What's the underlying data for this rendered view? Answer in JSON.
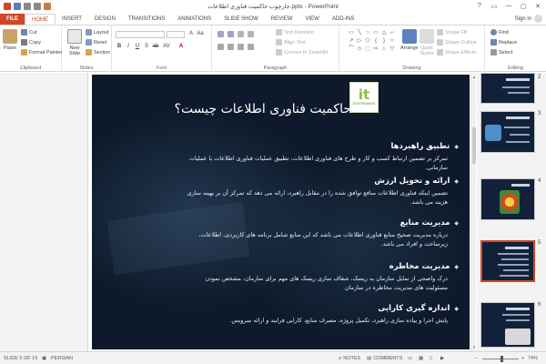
{
  "window": {
    "title": "جارچوب حاکمیت فناوری اطلاعات.pptx - PowerPoint",
    "controls": [
      "?",
      "▭",
      "—",
      "▢",
      "✕"
    ]
  },
  "ribbon_tabs": [
    "FILE",
    "HOME",
    "INSERT",
    "DESIGN",
    "TRANSITIONS",
    "ANIMATIONS",
    "SLIDE SHOW",
    "REVIEW",
    "VIEW",
    "ADD-INS"
  ],
  "active_tab": "HOME",
  "account": {
    "sign_in": "Sign in"
  },
  "ribbon": {
    "clipboard": {
      "paste": "Paste",
      "cut": "Cut",
      "copy": "Copy",
      "format_painter": "Format Painter",
      "label": "Clipboard"
    },
    "slides": {
      "new_slide": "New Slide",
      "layout": "Layout",
      "reset": "Reset",
      "section": "Section",
      "label": "Slides"
    },
    "font": {
      "label": "Font",
      "buttons": [
        "B",
        "I",
        "U",
        "S",
        "ab",
        "AV",
        "Aa",
        "A"
      ]
    },
    "paragraph": {
      "text_direction": "Text Direction",
      "align_text": "Align Text",
      "convert_smartart": "Convert to SmartArt",
      "label": "Paragraph"
    },
    "drawing": {
      "arrange": "Arrange",
      "quick_styles": "Quick Styles",
      "shape_fill": "Shape Fill",
      "shape_outline": "Shape Outline",
      "shape_effects": "Shape Effects",
      "label": "Drawing",
      "shapes": [
        "▭",
        "╲",
        "○",
        "▭",
        "△",
        "⌐",
        "↗",
        "▷",
        "⬠",
        "{",
        "}",
        "☆",
        "⌒",
        "◇",
        "⬚",
        "⇨",
        "⌂",
        "▽"
      ]
    },
    "editing": {
      "find": "Find",
      "replace": "Replace",
      "select": "Select",
      "label": "Editing"
    }
  },
  "slide": {
    "title": "حاکمیت فناوری اطلاعات چیست؟",
    "logo": {
      "glyph": "it",
      "subtitle": "GOVERNANCE"
    },
    "items": [
      {
        "heading": "تطبیق راهبردها",
        "body": "تمرکز بر تضمین ارتباط کسب و کار و طرح های فناوری اطلاعات، تطبیق عملیات فناوری اطلاعات با عملیات سازمانی."
      },
      {
        "heading": "ارائه و تحویل ارزش",
        "body": "تضمین اینکه فناوری اطلاعات منافع توافق شده را در مقابل راهبرد، ارائه می دهد که تمرکز آن بر بهینه سازی هزینه می باشد."
      },
      {
        "heading": "مدیریت منابع",
        "body": "درباره مدیریت صحیح منابع فناوری اطلاعات می باشد که این منابع شامل برنامه های کاربردی، اطلاعات، زیرساخت و افراد می باشد."
      },
      {
        "heading": "مدیریت مخاطره",
        "body": "درک واضحی از تمایل سازمان به ریسک، شفاف سازی ریسک های مهم برای سازمان، مشخص نمودن مسئولیت های مدیریت مخاطره در سازمان"
      },
      {
        "heading": "اندازه گیری کارایی",
        "body": "پایش اجرا و پیاده سازی راهبرد، تکمیل پروژه، مصرف منابع، کارایی فرایند و ارائه سرویس."
      }
    ]
  },
  "thumbnails": [
    {
      "number": "2",
      "selected": false
    },
    {
      "number": "3",
      "selected": false
    },
    {
      "number": "4",
      "selected": false
    },
    {
      "number": "5",
      "selected": true
    },
    {
      "number": "6",
      "selected": false
    }
  ],
  "status": {
    "slide_of": "SLIDE 5 OF 15",
    "language": "PERSIAN",
    "notes": "NOTES",
    "comments": "COMMENTS",
    "zoom": "74%"
  },
  "colors": {
    "accent": "#d24726",
    "slide_bg": "#0e1a2b",
    "logo_green": "#8cbf3f"
  }
}
